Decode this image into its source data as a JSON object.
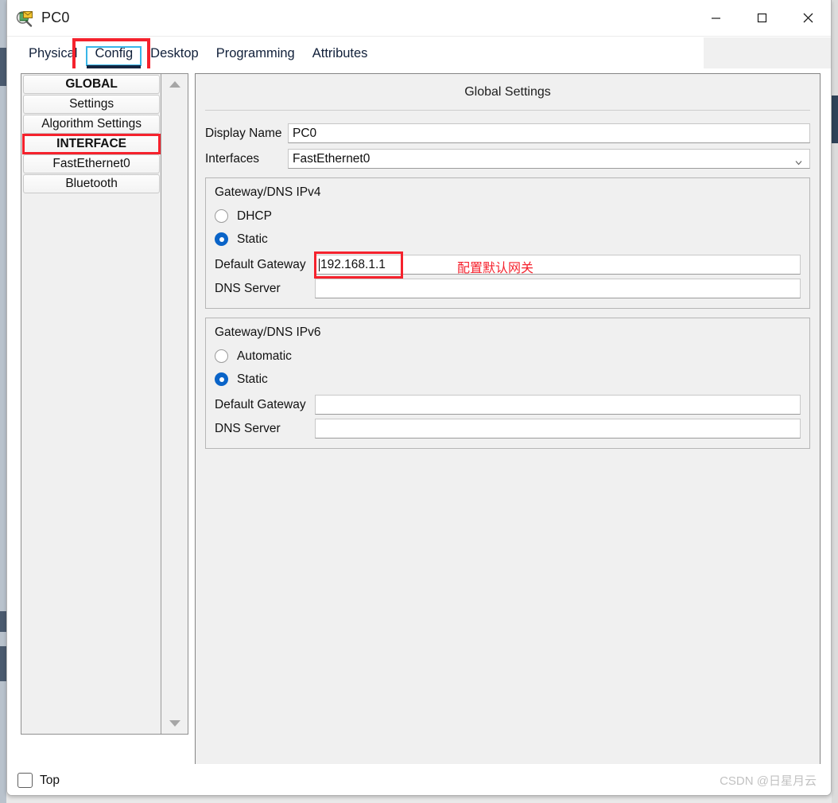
{
  "window": {
    "title": "PC0",
    "icon": "magnifier-envelope-icon",
    "controls": {
      "minimize": "—",
      "maximize": "□",
      "close": "✕"
    }
  },
  "tabs": [
    {
      "label": "Physical",
      "selected": false
    },
    {
      "label": "Config",
      "selected": true
    },
    {
      "label": "Desktop",
      "selected": false
    },
    {
      "label": "Programming",
      "selected": false
    },
    {
      "label": "Attributes",
      "selected": false
    }
  ],
  "sidebar": {
    "items": [
      {
        "label": "GLOBAL",
        "header": true,
        "flagged": false
      },
      {
        "label": "Settings",
        "header": false,
        "flagged": false
      },
      {
        "label": "Algorithm Settings",
        "header": false,
        "flagged": false
      },
      {
        "label": "INTERFACE",
        "header": true,
        "flagged": true
      },
      {
        "label": "FastEthernet0",
        "header": false,
        "flagged": false
      },
      {
        "label": "Bluetooth",
        "header": false,
        "flagged": false
      }
    ],
    "scroll_up": "scroll-up-arrow",
    "scroll_down": "scroll-down-arrow"
  },
  "main": {
    "panel_title": "Global Settings",
    "display_name": {
      "label": "Display Name",
      "value": "PC0"
    },
    "interfaces": {
      "label": "Interfaces",
      "value": "FastEthernet0"
    },
    "ipv4": {
      "title": "Gateway/DNS IPv4",
      "options": [
        {
          "label": "DHCP",
          "checked": false
        },
        {
          "label": "Static",
          "checked": true
        }
      ],
      "default_gateway": {
        "label": "Default Gateway",
        "value": "192.168.1.1"
      },
      "dns_server": {
        "label": "DNS Server",
        "value": ""
      },
      "annotation": "配置默认网关"
    },
    "ipv6": {
      "title": "Gateway/DNS IPv6",
      "options": [
        {
          "label": "Automatic",
          "checked": false
        },
        {
          "label": "Static",
          "checked": true
        }
      ],
      "default_gateway": {
        "label": "Default Gateway",
        "value": ""
      },
      "dns_server": {
        "label": "DNS Server",
        "value": ""
      }
    }
  },
  "footer": {
    "top_checkbox_label": "Top",
    "top_checked": false,
    "watermark": "CSDN @日星月云"
  },
  "colors": {
    "accent_blue": "#0a64c8",
    "annotation_red": "#f5222d",
    "focus_cyan": "#39b6e8",
    "panel_gray": "#f0f0f0"
  }
}
